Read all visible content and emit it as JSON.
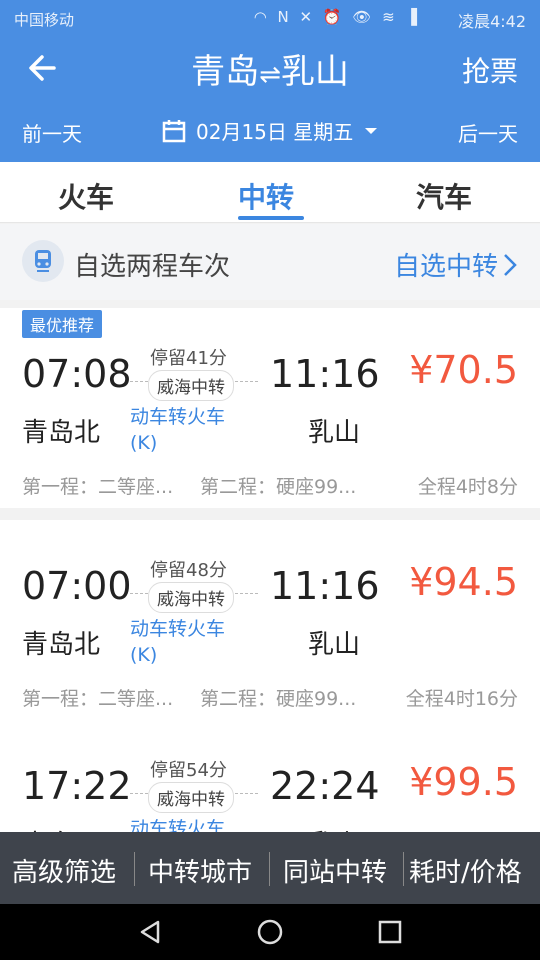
{
  "status": {
    "carrier": "中国移动",
    "icons": "◠ N ✕ ⏰ 👁 ≋ ▐",
    "time": "凌晨4:42"
  },
  "header": {
    "route_from": "青岛",
    "route_arrow": "⇌",
    "route_to": "乳山",
    "grab_label": "抢票",
    "prev_day": "前一天",
    "date": "02月15日 星期五",
    "next_day": "后一天"
  },
  "tabs": [
    {
      "label": "火车"
    },
    {
      "label": "中转"
    },
    {
      "label": "汽车"
    }
  ],
  "custom": {
    "label": "自选两程车次",
    "link": "自选中转"
  },
  "results": [
    {
      "badge": "最优推荐",
      "dep_time": "07:08",
      "arr_time": "11:16",
      "stop": "停留41分",
      "via": "威海中转",
      "type_line1": "动车转火车",
      "type_line2": "(K)",
      "dep_station": "青岛北",
      "arr_station": "乳山",
      "price": "¥70.5",
      "seg1": "第一程：二等座...",
      "seg2": "第二程：硬座99...",
      "total": "全程4时8分"
    },
    {
      "dep_time": "07:00",
      "arr_time": "11:16",
      "stop": "停留48分",
      "via": "威海中转",
      "type_line1": "动车转火车",
      "type_line2": "(K)",
      "dep_station": "青岛北",
      "arr_station": "乳山",
      "price": "¥94.5",
      "seg1": "第一程：二等座...",
      "seg2": "第二程：硬座99...",
      "total": "全程4时16分"
    },
    {
      "dep_time": "17:22",
      "arr_time": "22:24",
      "stop": "停留54分",
      "via": "威海中转",
      "type_line1": "动车转火车",
      "dep_station": "青岛",
      "arr_station": "乳山",
      "price": "¥99.5"
    }
  ],
  "filters": [
    {
      "label": "高级筛选"
    },
    {
      "label": "中转城市"
    },
    {
      "label": "同站中转"
    },
    {
      "label": "耗时/价格"
    }
  ],
  "colors": {
    "header": "#4a8ee2",
    "accent": "#3b86e0",
    "price": "#f2593f",
    "filter_bar": "#3f444c"
  }
}
